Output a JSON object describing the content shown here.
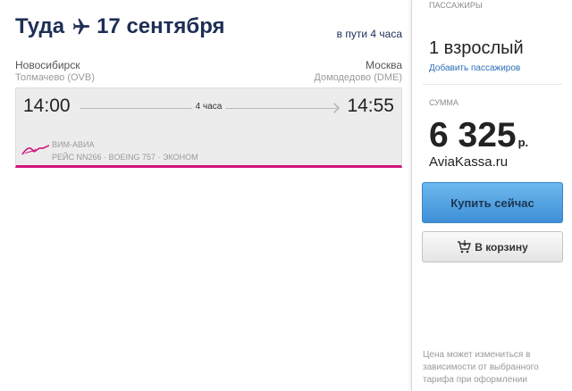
{
  "flight": {
    "direction": "Туда",
    "date": "17 сентября",
    "total_duration": "в пути 4 часа",
    "origin_city": "Новосибирск",
    "origin_airport": "Толмачево (OVB)",
    "destination_city": "Москва",
    "destination_airport": "Домодедово (DME)",
    "departure_time": "14:00",
    "arrival_time": "14:55",
    "flight_duration": "4 часа",
    "airline": "ВИМ-АВИА",
    "details": "РЕЙС NN266 · BOEING 757 · ЭКОНОМ",
    "accent_color": "#d0137c"
  },
  "sidebar": {
    "passengers_label": "ПАССАЖИРЫ",
    "passengers_value": "1 взрослый",
    "add_passengers": "Добавить пассажиров",
    "sum_label": "СУММА",
    "price": "6 325",
    "currency": "р.",
    "brand": "AviaKassa.ru",
    "buy_button": "Купить сейчас",
    "cart_button": "В корзину",
    "note": "Цена может измениться в зависимости от выбранного тарифа при оформлении",
    "buy_color": "#4fa3e3"
  },
  "icons": [
    "plane-icon",
    "cart-icon",
    "airline-logo",
    "arrow-icon"
  ]
}
